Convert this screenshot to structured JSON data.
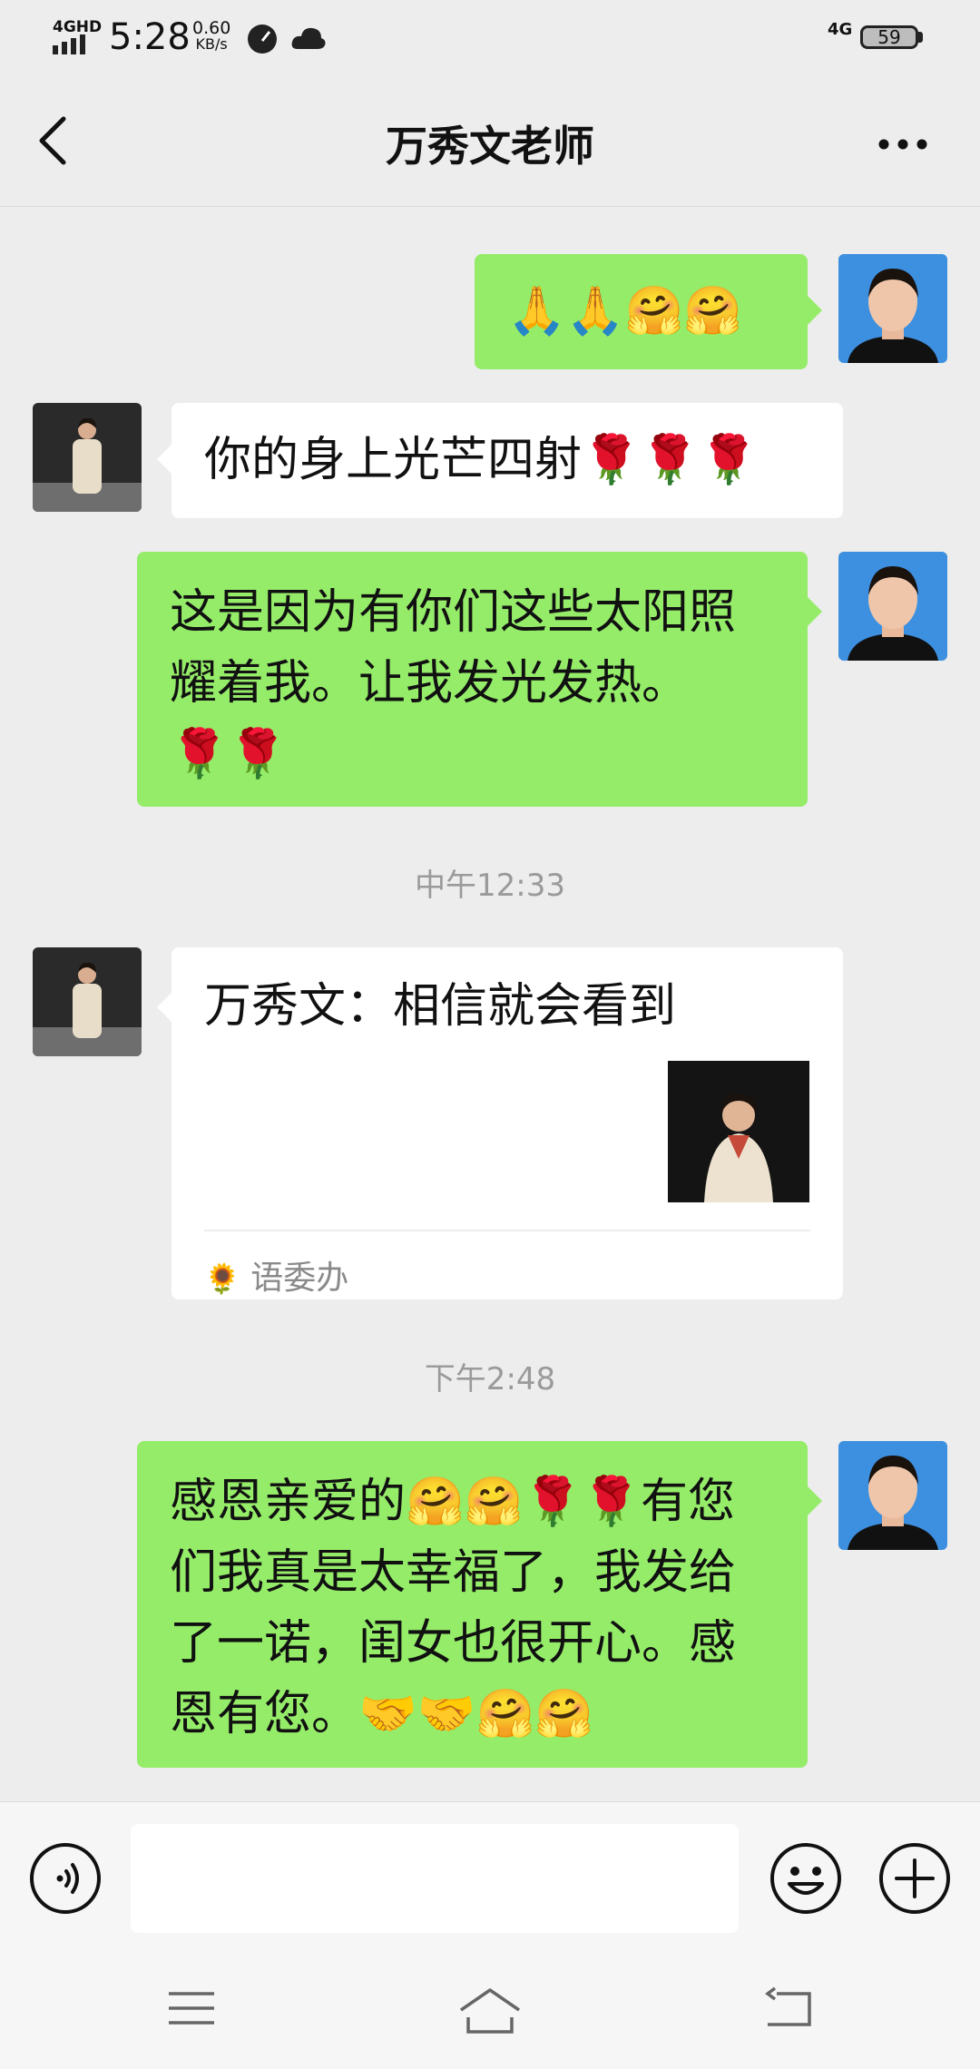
{
  "status_bar": {
    "network_type": "4GHD",
    "time": "5:28",
    "speed_value": "0.60",
    "speed_unit": "KB/s",
    "network_right": "4G",
    "battery": "59"
  },
  "header": {
    "title": "万秀文老师",
    "icons": [
      "chevron-left-icon",
      "more-icon"
    ]
  },
  "messages": [
    {
      "side": "right",
      "text": "🙏🙏🤗🤗"
    },
    {
      "side": "left",
      "text": "你的身上光芒四射🌹🌹🌹"
    },
    {
      "side": "right",
      "lines": [
        "这是因为有你们这些太阳照",
        "耀着我。让我发光发热。",
        "🌹🌹"
      ]
    },
    {
      "type": "time",
      "text": "中午12:33"
    },
    {
      "side": "left",
      "type": "card",
      "text": "万秀文：相信就会看到",
      "source": "语委办",
      "source_icon": "🌻"
    },
    {
      "type": "time",
      "text": "下午2:48"
    },
    {
      "side": "right",
      "lines": [
        "感恩亲爱的🤗🤗🌹🌹有您",
        "们我真是太幸福了，我发给",
        "了一诺，闺女也很开心。感",
        "恩有您。🤝🤝🤗🤗"
      ]
    }
  ],
  "input_bar": {
    "icons": [
      "voice-icon",
      "emoji-icon",
      "plus-icon"
    ]
  },
  "nav_bar": {
    "icons": [
      "menu-icon",
      "home-icon",
      "back-icon"
    ]
  }
}
